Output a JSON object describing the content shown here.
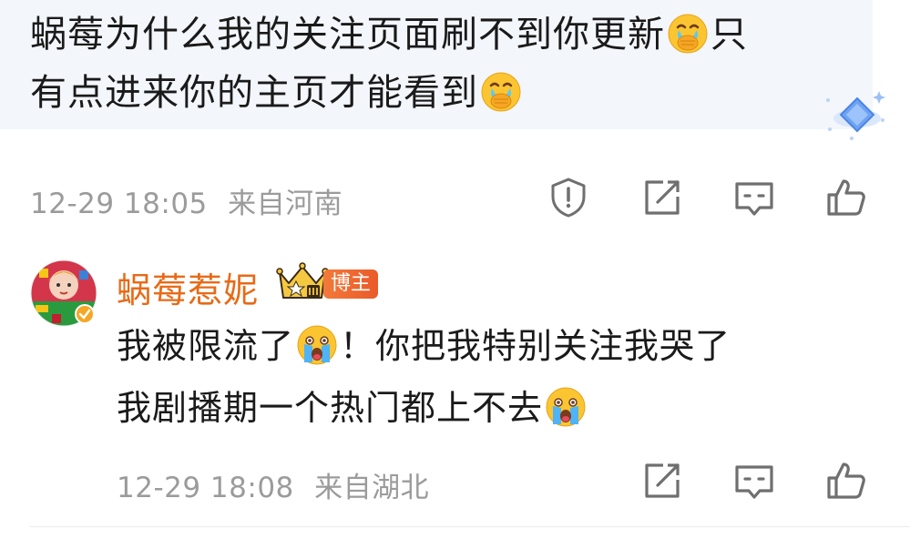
{
  "quoted_comment": {
    "line1_text": "蜗莓为什么我的关注页面刷不到你更新",
    "line1_tail": "只",
    "line2_text": "有点进来你的主页才能看到",
    "emoji": "covering-mouth-tears-emoji",
    "timestamp": "12-29 18:05",
    "location": "来自河南"
  },
  "reply": {
    "username": "蜗莓惹妮",
    "badge": "博主",
    "rank_icon": "crown-rank-icon",
    "line1_a": "我被限流了",
    "line1_b": "！你把我特别关注我哭了",
    "line2_a": "我剧播期一个热门都上不去",
    "emoji": "loudly-crying-emoji",
    "timestamp": "12-29 18:08",
    "location": "来自湖北"
  },
  "actions": {
    "report": "alert-shield-icon",
    "repost": "edit-share-icon",
    "comment": "comment-bubble-icon",
    "like": "thumbs-up-icon"
  },
  "colors": {
    "username": "#e86a17",
    "meta": "#9b9b9b",
    "badge": "#ea5a28",
    "quote_bg": "#f3f6fb"
  }
}
